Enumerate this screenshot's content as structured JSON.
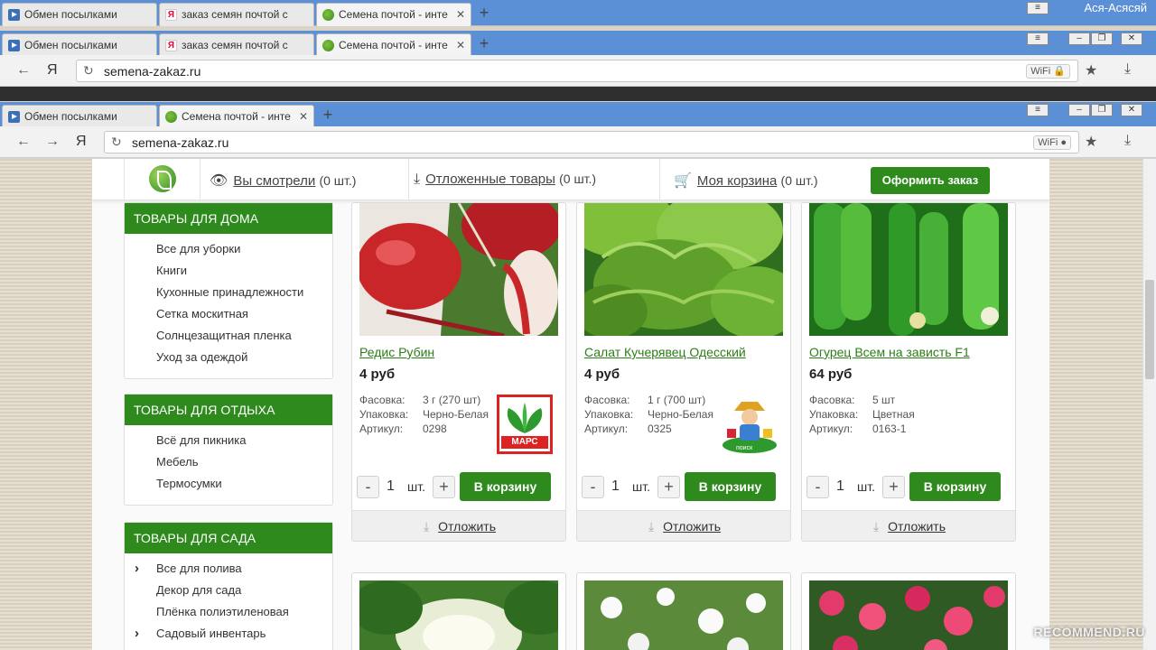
{
  "browser": {
    "user_name": "Ася-Асясяй",
    "tabs_row1": [
      {
        "label": "Обмен посылками",
        "icon": "video-icon"
      },
      {
        "label": "заказ семян почтой с",
        "icon": "yandex-icon"
      },
      {
        "label": "Семена почтой - инте",
        "icon": "leaf-icon"
      }
    ],
    "tabs_row2": [
      {
        "label": "Обмен посылками",
        "icon": "video-icon"
      },
      {
        "label": "заказ семян почтой с",
        "icon": "yandex-icon"
      },
      {
        "label": "Семена почтой - инте",
        "icon": "leaf-icon"
      }
    ],
    "tabs_row3": [
      {
        "label": "Обмен посылками",
        "icon": "video-icon"
      },
      {
        "label": "Семена почтой - инте",
        "icon": "leaf-icon"
      }
    ],
    "url": "semena-zakaz.ru",
    "wifi_label": "WiFi",
    "new_tab": "+",
    "yandex_letter": "Я"
  },
  "header": {
    "viewed_label": "Вы смотрели",
    "viewed_count": "(0 шт.)",
    "deferred_label": "Отложенные товары",
    "deferred_count": "(0 шт.)",
    "cart_label": "Моя корзина",
    "cart_count": "(0 шт.)",
    "checkout_label": "Оформить заказ"
  },
  "categories": [
    {
      "title": "Товары для дома",
      "items": [
        "Все для уборки",
        "Книги",
        "Кухонные принадлежности",
        "Сетка москитная",
        "Солнцезащитная пленка",
        "Уход за одеждой"
      ]
    },
    {
      "title": "Товары для отдыха",
      "items": [
        "Всё для пикника",
        "Мебель",
        "Термосумки"
      ]
    },
    {
      "title": "Товары для сада",
      "items": [
        "Все для полива",
        "Декор для сада",
        "Плёнка полиэтиленовая",
        "Садовый инвентарь"
      ]
    }
  ],
  "spec_labels": {
    "packing": "Фасовка:",
    "package": "Упаковка:",
    "article": "Артикул:"
  },
  "products": [
    {
      "name": "Редис Рубин",
      "price": "4 руб",
      "packing": "3 г (270 шт)",
      "package": "Черно-Белая",
      "article": "0298",
      "brand": "МАРС"
    },
    {
      "name": "Салат Кучерявец Одесский",
      "price": "4 руб",
      "packing": "1 г (700 шт)",
      "package": "Черно-Белая",
      "article": "0325",
      "brand": "поиск"
    },
    {
      "name": "Огурец Всем на зависть F1",
      "price": "64 руб",
      "packing": "5 шт",
      "package": "Цветная",
      "article": "0163-1",
      "brand": ""
    }
  ],
  "cart_controls": {
    "minus": "-",
    "plus": "+",
    "qty": "1",
    "unit": "шт.",
    "add_label": "В корзину",
    "defer_label": "Отложить"
  },
  "watermark": "RECOMMEND.RU",
  "colors": {
    "brand_green": "#2e8a1d",
    "link_green": "#2a7f14",
    "chrome_blue": "#5b8fd6"
  }
}
